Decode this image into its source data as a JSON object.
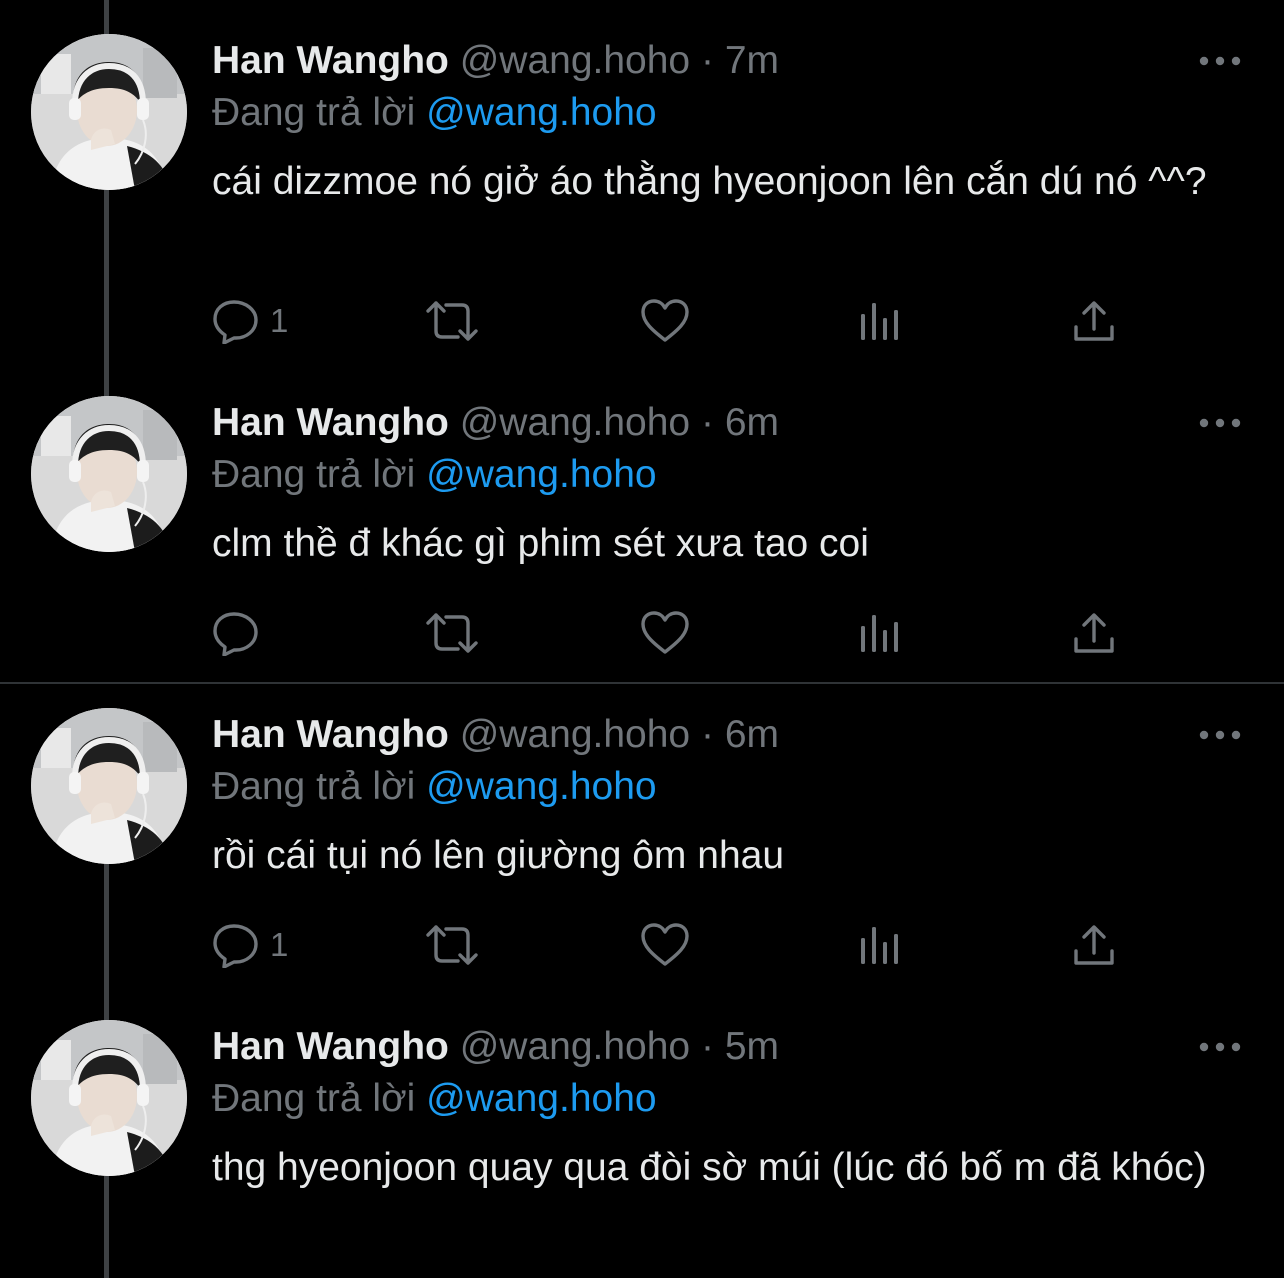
{
  "tweets": [
    {
      "name": "Han Wangho",
      "handle": "@wang.hoho",
      "separator": "·",
      "time": "7m",
      "reply_prefix": "Đang trả lời",
      "reply_to": "@wang.hoho",
      "text": "cái dizzmoe nó giở áo thằng hyeonjoon lên cắn dú nó ^^?",
      "reply_count": "1"
    },
    {
      "name": "Han Wangho",
      "handle": "@wang.hoho",
      "separator": "·",
      "time": "6m",
      "reply_prefix": "Đang trả lời",
      "reply_to": "@wang.hoho",
      "text": "clm thề đ khác gì phim sét xưa tao coi",
      "reply_count": ""
    },
    {
      "name": "Han Wangho",
      "handle": "@wang.hoho",
      "separator": "·",
      "time": "6m",
      "reply_prefix": "Đang trả lời",
      "reply_to": "@wang.hoho",
      "text": "rồi cái tụi nó lên giường ôm nhau",
      "reply_count": "1"
    },
    {
      "name": "Han Wangho",
      "handle": "@wang.hoho",
      "separator": "·",
      "time": "5m",
      "reply_prefix": "Đang trả lời",
      "reply_to": "@wang.hoho",
      "text": "thg hyeonjoon quay qua đòi sờ múi (lúc đó bố m đã khóc)",
      "reply_count": ""
    }
  ],
  "icons": {
    "more": "more-horizontal-icon",
    "reply": "reply-bubble-icon",
    "retweet": "retweet-icon",
    "like": "heart-icon",
    "views": "analytics-bars-icon",
    "share": "share-upload-icon"
  },
  "colors": {
    "background": "#000000",
    "text": "#e7e9ea",
    "secondary": "#71767b",
    "mention": "#1d9bf0",
    "thread_line": "#3e4144"
  }
}
